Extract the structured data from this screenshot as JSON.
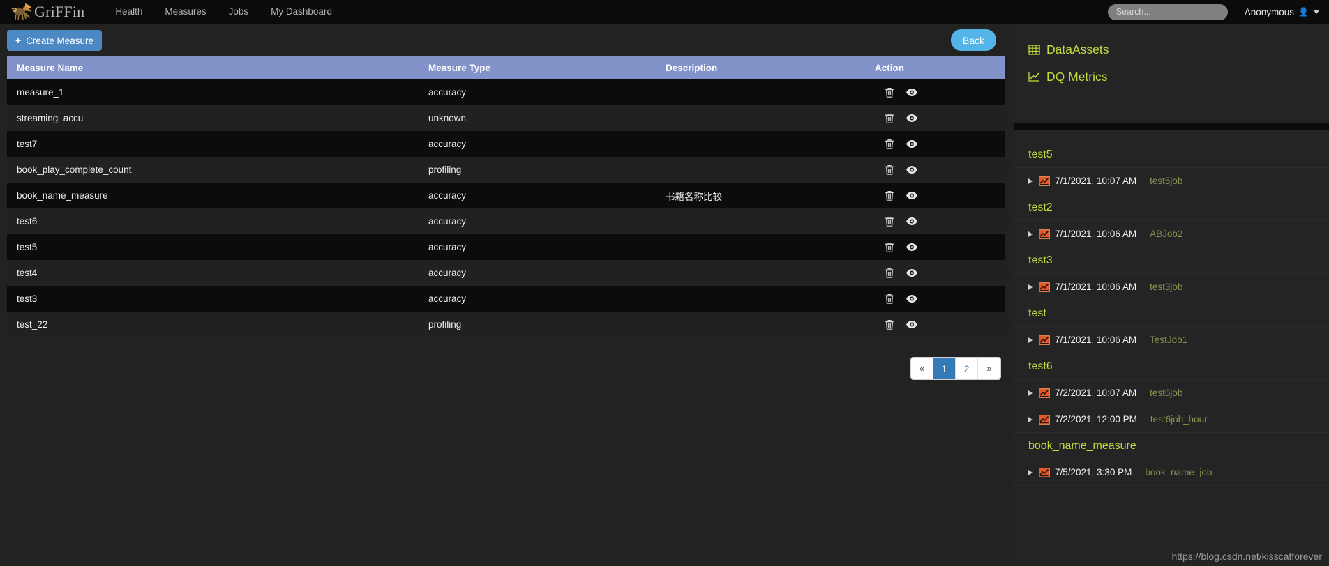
{
  "navbar": {
    "brand": "GriFFin",
    "brand_icon": "griffin-logo-icon",
    "links": [
      "Health",
      "Measures",
      "Jobs",
      "My Dashboard"
    ],
    "search_placeholder": "Search...",
    "search_value": "",
    "user_name": "Anonymous",
    "user_icon": "user-icon",
    "caret_icon": "caret-down-icon"
  },
  "toolbar": {
    "create_label": "Create Measure",
    "create_plus": "+",
    "back_label": "Back"
  },
  "table": {
    "columns": [
      "Measure Name",
      "Measure Type",
      "Description",
      "Action"
    ],
    "action_icons": [
      "trash-icon",
      "eye-icon"
    ],
    "rows": [
      {
        "name": "measure_1",
        "type": "accuracy",
        "description": ""
      },
      {
        "name": "streaming_accu",
        "type": "unknown",
        "description": ""
      },
      {
        "name": "test7",
        "type": "accuracy",
        "description": ""
      },
      {
        "name": "book_play_complete_count",
        "type": "profiling",
        "description": ""
      },
      {
        "name": "book_name_measure",
        "type": "accuracy",
        "description": "书籍名称比较"
      },
      {
        "name": "test6",
        "type": "accuracy",
        "description": ""
      },
      {
        "name": "test5",
        "type": "accuracy",
        "description": ""
      },
      {
        "name": "test4",
        "type": "accuracy",
        "description": ""
      },
      {
        "name": "test3",
        "type": "accuracy",
        "description": ""
      },
      {
        "name": "test_22",
        "type": "profiling",
        "description": ""
      }
    ]
  },
  "pagination": {
    "first_label": "«",
    "last_label": "»",
    "pages": [
      "1",
      "2"
    ],
    "active_page": "1"
  },
  "sidebar": {
    "links": [
      {
        "label": "DataAssets",
        "icon": "table-grid-icon"
      },
      {
        "label": "DQ Metrics",
        "icon": "chart-line-icon"
      }
    ],
    "groups": [
      {
        "name": "test5",
        "items": [
          {
            "date": "7/1/2021, 10:07 AM",
            "job": "test5job",
            "icon": "metric-chart-icon",
            "caret": "caret-right-icon"
          }
        ]
      },
      {
        "name": "test2",
        "items": [
          {
            "date": "7/1/2021, 10:06 AM",
            "job": "ABJob2",
            "icon": "metric-chart-icon",
            "caret": "caret-right-icon"
          }
        ]
      },
      {
        "name": "test3",
        "items": [
          {
            "date": "7/1/2021, 10:06 AM",
            "job": "test3job",
            "icon": "metric-chart-icon",
            "caret": "caret-right-icon"
          }
        ]
      },
      {
        "name": "test",
        "items": [
          {
            "date": "7/1/2021, 10:06 AM",
            "job": "TestJob1",
            "icon": "metric-chart-icon",
            "caret": "caret-right-icon"
          }
        ]
      },
      {
        "name": "test6",
        "items": [
          {
            "date": "7/2/2021, 10:07 AM",
            "job": "test6job",
            "icon": "metric-chart-icon",
            "caret": "caret-right-icon"
          },
          {
            "date": "7/2/2021, 12:00 PM",
            "job": "test6job_hour",
            "icon": "metric-chart-icon",
            "caret": "caret-right-icon"
          }
        ]
      },
      {
        "name": "book_name_measure",
        "items": [
          {
            "date": "7/5/2021, 3:30 PM",
            "job": "book_name_job",
            "icon": "metric-chart-icon",
            "caret": "caret-right-icon"
          }
        ]
      }
    ]
  },
  "watermark": "https://blog.csdn.net/kisscatforever",
  "colors": {
    "accent_blue": "#4b88c4",
    "back_blue": "#54b4e8",
    "table_header": "#8193c8",
    "sidebar_green": "#c5d93f",
    "job_olive": "#8c9050",
    "page_active": "#337ab7",
    "metric_orange": "#e2582a"
  }
}
